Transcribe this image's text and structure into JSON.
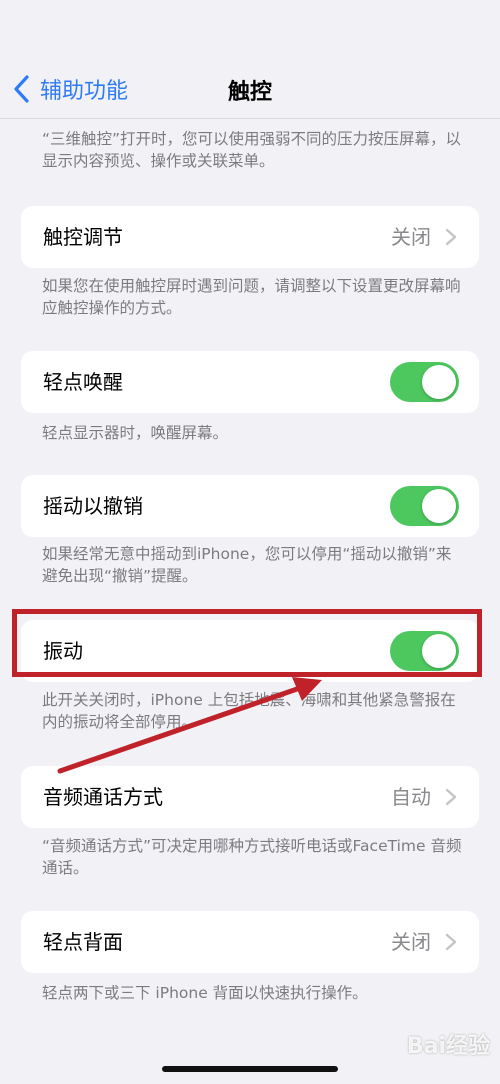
{
  "nav": {
    "back_label": "辅助功能",
    "title": "触控"
  },
  "top_note": "“三维触控”打开时，您可以使用强弱不同的压力按压屏幕，以显示内容预览、操作或关联菜单。",
  "rows": [
    {
      "label": "触控调节",
      "value": "关闭",
      "note": "如果您在使用触控屏时遇到问题，请调整以下设置更改屏幕响应触控操作的方式。"
    },
    {
      "label": "轻点唤醒",
      "toggle_on": true,
      "note": "轻点显示器时，唤醒屏幕。"
    },
    {
      "label": "摇动以撤销",
      "toggle_on": true,
      "note": "如果经常无意中摇动到iPhone，您可以停用“摇动以撤销”来避免出现“撤销”提醒。"
    },
    {
      "label": "振动",
      "toggle_on": true,
      "note": "此开关关闭时，iPhone 上包括地震、海啸和其他紧急警报在内的振动将全部停用。"
    },
    {
      "label": "音频通话方式",
      "value": "自动",
      "note": "“音频通话方式”可决定用哪种方式接听电话或FaceTime 音频通话。"
    },
    {
      "label": "轻点背面",
      "value": "关闭",
      "note": "轻点两下或三下 iPhone 背面以快速执行操作。"
    }
  ],
  "colors": {
    "accent": "#2f7bf5",
    "toggle_on": "#4cc85f",
    "annotation": "#c0222a"
  },
  "watermark": "Bai经验"
}
